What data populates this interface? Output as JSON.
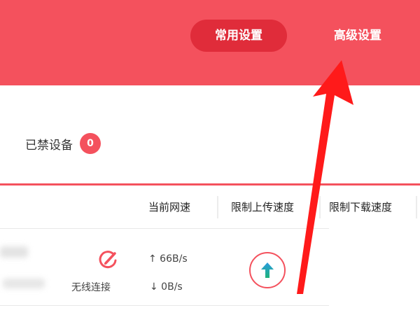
{
  "header": {
    "tabs": [
      {
        "label": "常用设置",
        "active": true
      },
      {
        "label": "高级设置",
        "active": false
      }
    ],
    "color": "#f4515d",
    "active_tab_color": "#e02c3a"
  },
  "blocked_devices": {
    "label": "已禁设备",
    "count": "0"
  },
  "table": {
    "headers": {
      "current_speed": "当前网速",
      "upload_limit": "限制上传速度",
      "download_limit": "限制下载速度"
    },
    "rows": [
      {
        "connection": "无线连接",
        "up": "↑ 66B/s",
        "down": "↓ 0B/s",
        "edit_icon": "edit-icon",
        "upload_icon": "upload-arrow-icon"
      }
    ]
  },
  "annotation": {
    "arrow_color": "#ff1a1a"
  }
}
